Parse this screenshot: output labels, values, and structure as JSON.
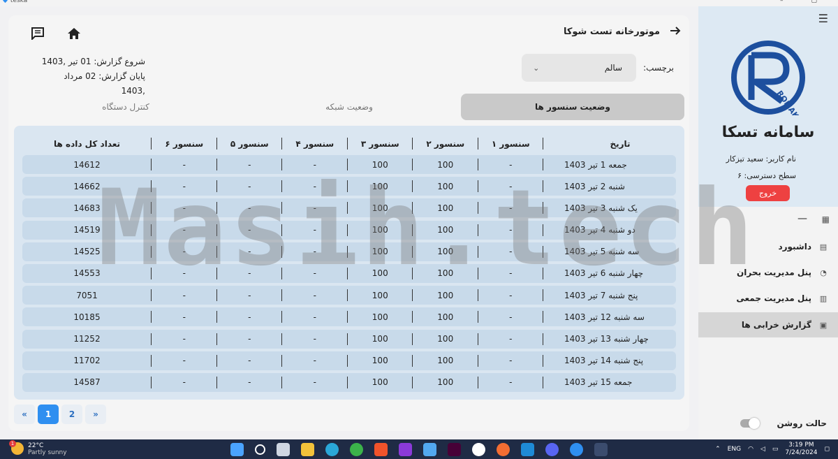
{
  "window": {
    "app_name": "teska"
  },
  "header": {
    "page_title": "موتورخانه تست شوکا",
    "back_icon": "arrow-right-icon",
    "home_icon": "home-icon",
    "message_icon": "message-icon"
  },
  "report": {
    "start": "شروع گزارش: 01 تیر  ,1403",
    "end": "پایان گزارش: 02 مرداد  ,1403"
  },
  "tag": {
    "label": "برچسب:",
    "value": "سالم"
  },
  "tabs": [
    {
      "label": "وضعیت سنسور ها",
      "active": true
    },
    {
      "label": "وضعیت شبکه",
      "active": false
    },
    {
      "label": "کنترل دستگاه",
      "active": false
    }
  ],
  "table": {
    "headers": [
      "تاریخ",
      "سنسور ۱",
      "سنسور ۲",
      "سنسور ۳",
      "سنسور ۴",
      "سنسور ۵",
      "سنسور ۶",
      "تعداد کل داده ها"
    ],
    "rows": [
      [
        "جمعه 1 تیر 1403",
        "-",
        "100",
        "100",
        "-",
        "-",
        "-",
        "14612"
      ],
      [
        "شنبه 2 تیر 1403",
        "-",
        "100",
        "100",
        "-",
        "-",
        "-",
        "14662"
      ],
      [
        "یک شنبه 3 تیر 1403",
        "-",
        "100",
        "100",
        "-",
        "-",
        "-",
        "14683"
      ],
      [
        "دو شنبه 4 تیر 1403",
        "-",
        "100",
        "100",
        "-",
        "-",
        "-",
        "14519"
      ],
      [
        "سه شنبه 5 تیر 1403",
        "-",
        "100",
        "100",
        "-",
        "-",
        "-",
        "14525"
      ],
      [
        "چهار شنبه 6 تیر 1403",
        "-",
        "100",
        "100",
        "-",
        "-",
        "-",
        "14553"
      ],
      [
        "پنج شنبه 7 تیر 1403",
        "-",
        "100",
        "100",
        "-",
        "-",
        "-",
        "7051"
      ],
      [
        "سه شنبه 12 تیر 1403",
        "-",
        "100",
        "100",
        "-",
        "-",
        "-",
        "10185"
      ],
      [
        "چهار شنبه 13 تیر 1403",
        "-",
        "100",
        "100",
        "-",
        "-",
        "-",
        "11252"
      ],
      [
        "پنج شنبه 14 تیر 1403",
        "-",
        "100",
        "100",
        "-",
        "-",
        "-",
        "11702"
      ],
      [
        "جمعه 15 تیر 1403",
        "-",
        "100",
        "100",
        "-",
        "-",
        "-",
        "14587"
      ]
    ]
  },
  "pagination": {
    "prev": "«",
    "pages": [
      "1",
      "2"
    ],
    "current": "1",
    "next": "»"
  },
  "sidebar": {
    "system_title": "سامانه تسکا",
    "user": "نام کاربر: سعید تیزکار",
    "access_level": "سطح دسترسی: ۶",
    "logout": "خروج",
    "logo_text": "ROMAK",
    "nav": [
      {
        "label": "داشبورد",
        "icon": "dashboard-icon",
        "active": false
      },
      {
        "label": "پنل مدیریت بحران",
        "icon": "pie-chart-icon",
        "active": false
      },
      {
        "label": "پنل مدیریت جمعی",
        "icon": "bar-chart-icon",
        "active": false
      },
      {
        "label": "گزارش خرابی ها",
        "icon": "report-icon",
        "active": true
      }
    ],
    "theme_label": "حالت روشن"
  },
  "watermark": "Masih.tech",
  "taskbar": {
    "temperature": "22°C",
    "weather": "Partly sunny",
    "notification_count": "1",
    "language": "ENG",
    "time": "3:19 PM",
    "date": "7/24/2024"
  },
  "colors": {
    "accent": "#2f8ff0",
    "logout": "#ee4141",
    "table_bg": "#dae6f1",
    "row_bg": "#c8daea",
    "logo_blue": "#1d4f9e"
  }
}
